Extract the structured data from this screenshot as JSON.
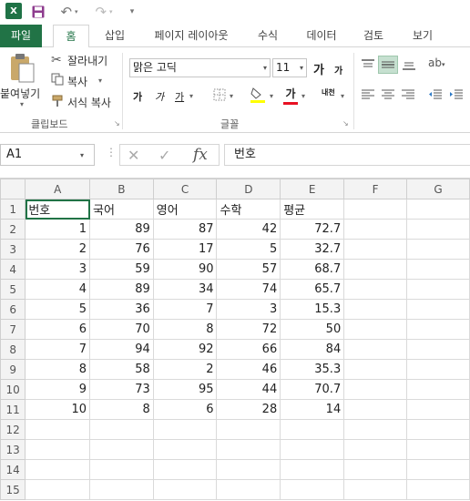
{
  "qat": {
    "logo": "X",
    "save_icon": "save-icon",
    "undo_icon": "undo-icon",
    "redo_icon": "redo-icon",
    "more": "▾"
  },
  "tabs": [
    "파일",
    "홈",
    "삽입",
    "페이지 레이아웃",
    "수식",
    "데이터",
    "검토",
    "보기"
  ],
  "ribbon": {
    "clipboard": {
      "paste_label": "붙여넣기",
      "cut_label": "잘라내기",
      "copy_label": "복사",
      "format_painter_label": "서식 복사",
      "group_label": "클립보드"
    },
    "font": {
      "font_name": "맑은 고딕",
      "font_size": "11",
      "grow_label": "가",
      "shrink_label": "가",
      "bold_label": "가",
      "italic_label": "가",
      "underline_label": "가",
      "font_color_label": "가",
      "phonetic_label": "내천",
      "group_label": "글꼴"
    }
  },
  "formula_bar": {
    "namebox": "A1",
    "value": "번호",
    "fx": "fx"
  },
  "sheet": {
    "columns": [
      "A",
      "B",
      "C",
      "D",
      "E",
      "F",
      "G"
    ],
    "row_numbers": [
      "1",
      "2",
      "3",
      "4",
      "5",
      "6",
      "7",
      "8",
      "9",
      "10",
      "11",
      "12",
      "13",
      "14",
      "15"
    ],
    "header": [
      "번호",
      "국어",
      "영어",
      "수학",
      "평균"
    ],
    "rows": [
      [
        "1",
        "89",
        "87",
        "42",
        "72.7"
      ],
      [
        "2",
        "76",
        "17",
        "5",
        "32.7"
      ],
      [
        "3",
        "59",
        "90",
        "57",
        "68.7"
      ],
      [
        "4",
        "89",
        "34",
        "74",
        "65.7"
      ],
      [
        "5",
        "36",
        "7",
        "3",
        "15.3"
      ],
      [
        "6",
        "70",
        "8",
        "72",
        "50"
      ],
      [
        "7",
        "94",
        "92",
        "66",
        "84"
      ],
      [
        "8",
        "58",
        "2",
        "46",
        "35.3"
      ],
      [
        "9",
        "73",
        "95",
        "44",
        "70.7"
      ],
      [
        "10",
        "8",
        "6",
        "28",
        "14"
      ]
    ]
  },
  "colors": {
    "accent": "#217346",
    "highlight_fill": "#ffff00",
    "font_color_bar": "#e81123"
  }
}
